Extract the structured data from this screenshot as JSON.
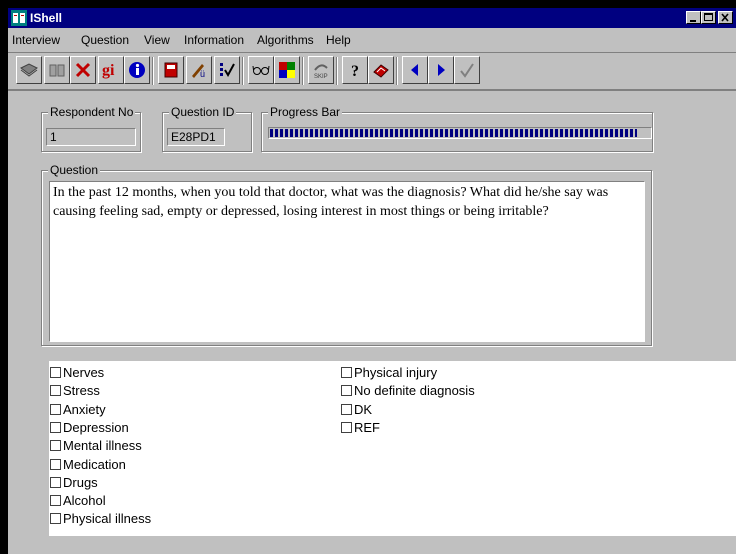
{
  "window": {
    "title": "IShell"
  },
  "menu": [
    {
      "label": "Interview"
    },
    {
      "label": "Question"
    },
    {
      "label": "View"
    },
    {
      "label": "Information"
    },
    {
      "label": "Algorithms"
    },
    {
      "label": "Help"
    }
  ],
  "toolbar": {
    "buttons": [
      "book-icon",
      "book-open-icon",
      "delete-x-icon",
      "gi-icon",
      "info-icon",
      "notebook-icon",
      "edit-icon",
      "checklist-icon",
      "glasses-icon",
      "color-palette-icon",
      "skip-icon",
      "help-icon",
      "reference-book-icon",
      "previous-arrow-icon",
      "next-arrow-icon",
      "checkmark-icon"
    ],
    "gi_label": "gi",
    "skip_label": "SKIP"
  },
  "respondent": {
    "label": "Respondent No",
    "value": "1"
  },
  "question_id": {
    "label": "Question ID",
    "value": "E28PD1"
  },
  "progress": {
    "label": "Progress Bar",
    "fraction": 0.96
  },
  "question": {
    "label": "Question",
    "text": "In the past 12 months, when you told that doctor, what was the diagnosis? What did he/she say was causing feeling sad, empty or depressed, losing interest in most things or being irritable?"
  },
  "answers": {
    "left": [
      "Nerves",
      "Stress",
      "Anxiety",
      "Depression",
      "Mental illness",
      "Medication",
      "Drugs",
      "Alcohol",
      "Physical illness"
    ],
    "right": [
      "Physical injury",
      "No definite diagnosis",
      "DK",
      "REF"
    ]
  },
  "colors": {
    "titlebar": "#000080",
    "face": "#c0c0c0"
  }
}
